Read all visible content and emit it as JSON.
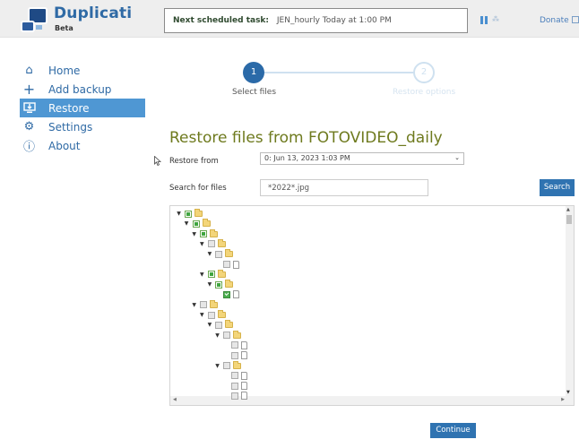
{
  "header": {
    "app_title": "Duplicati",
    "app_subtitle": "Beta",
    "scheduled_label": "Next scheduled task:",
    "scheduled_value": "JEN_hourly Today at 1:00 PM",
    "donate_label": "Donate"
  },
  "sidebar": {
    "items": [
      {
        "label": "Home",
        "icon": "home-icon",
        "active": false
      },
      {
        "label": "Add backup",
        "icon": "plus-icon",
        "active": false
      },
      {
        "label": "Restore",
        "icon": "restore-icon",
        "active": true
      },
      {
        "label": "Settings",
        "icon": "gear-icon",
        "active": false
      },
      {
        "label": "About",
        "icon": "info-icon",
        "active": false
      }
    ]
  },
  "stepper": {
    "steps": [
      {
        "number": "1",
        "label": "Select files",
        "active": true
      },
      {
        "number": "2",
        "label": "Restore options",
        "active": false
      }
    ]
  },
  "main": {
    "title": "Restore files from FOTOVIDEO_daily",
    "restore_from_label": "Restore from",
    "restore_from_value": "0: Jun 13, 2023 1:03 PM",
    "search_label": "Search for files",
    "search_value": "*2022*.jpg",
    "search_button": "Search",
    "continue_button": "Continue"
  },
  "tree": {
    "nodes": [
      {
        "depth": 0,
        "type": "folder",
        "state": "partial",
        "expanded": true
      },
      {
        "depth": 1,
        "type": "folder",
        "state": "partial",
        "expanded": true
      },
      {
        "depth": 2,
        "type": "folder",
        "state": "partial",
        "expanded": true
      },
      {
        "depth": 3,
        "type": "folder",
        "state": "unchecked",
        "expanded": true
      },
      {
        "depth": 4,
        "type": "folder",
        "state": "unchecked",
        "expanded": true
      },
      {
        "depth": 5,
        "type": "file",
        "state": "unchecked"
      },
      {
        "depth": 3,
        "type": "folder",
        "state": "partial",
        "expanded": true
      },
      {
        "depth": 4,
        "type": "folder",
        "state": "partial",
        "expanded": true
      },
      {
        "depth": 5,
        "type": "file",
        "state": "checked"
      },
      {
        "depth": 2,
        "type": "folder",
        "state": "unchecked",
        "expanded": true
      },
      {
        "depth": 3,
        "type": "folder",
        "state": "unchecked",
        "expanded": true
      },
      {
        "depth": 4,
        "type": "folder",
        "state": "unchecked",
        "expanded": true
      },
      {
        "depth": 5,
        "type": "folder",
        "state": "unchecked",
        "expanded": true
      },
      {
        "depth": 6,
        "type": "file",
        "state": "unchecked"
      },
      {
        "depth": 6,
        "type": "file",
        "state": "unchecked"
      },
      {
        "depth": 5,
        "type": "folder",
        "state": "unchecked",
        "expanded": true
      },
      {
        "depth": 6,
        "type": "file",
        "state": "unchecked"
      },
      {
        "depth": 6,
        "type": "file",
        "state": "unchecked"
      },
      {
        "depth": 6,
        "type": "file",
        "state": "unchecked"
      }
    ]
  }
}
